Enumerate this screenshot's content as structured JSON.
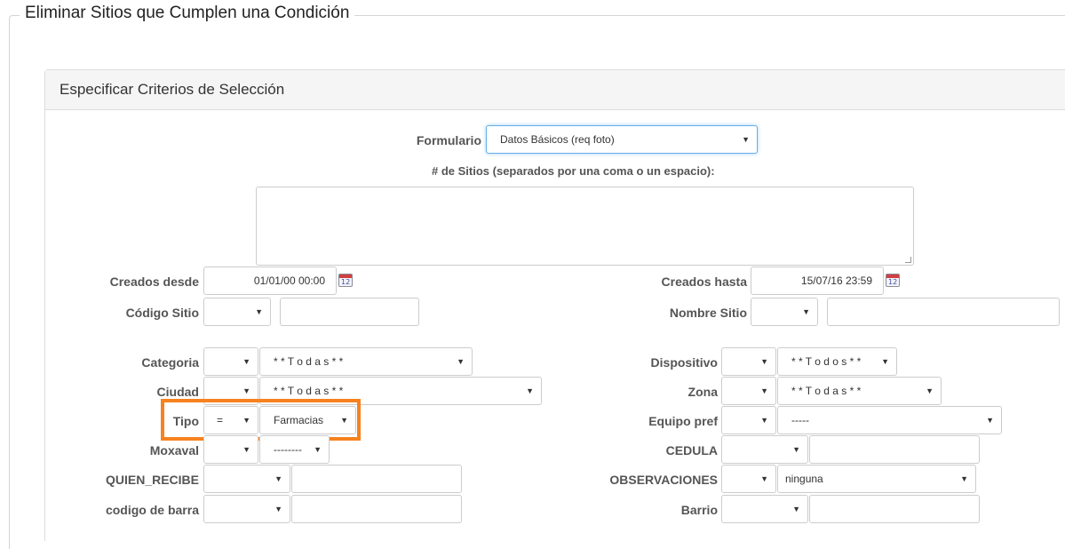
{
  "page_title": "Eliminar Sitios que Cumplen una Condición",
  "panel_title": "Especificar Criterios de Selección",
  "formulario": {
    "label": "Formulario",
    "value": "Datos Básicos (req foto)"
  },
  "sitios": {
    "label": "# de Sitios (separados por una coma o un espacio):",
    "value": ""
  },
  "creados_desde": {
    "label": "Creados desde",
    "value": "01/01/00 00:00"
  },
  "creados_hasta": {
    "label": "Creados hasta",
    "value": "15/07/16 23:59"
  },
  "calendar_icon_text": "12",
  "left_fields": {
    "codigo_sitio": {
      "label": "Código Sitio",
      "op": "",
      "value": ""
    },
    "categoria": {
      "label": "Categoria",
      "op": "",
      "value": "* * T o d a s * *"
    },
    "ciudad": {
      "label": "Ciudad",
      "op": "",
      "value": "* * T o d a s * *"
    },
    "tipo": {
      "label": "Tipo",
      "op": "=",
      "value": "Farmacias"
    },
    "moxaval": {
      "label": "Moxaval",
      "op": "",
      "value": "--------"
    },
    "quien_recibe": {
      "label": "QUIEN_RECIBE",
      "op": "",
      "value": ""
    },
    "codigo_barra": {
      "label": "codigo de barra",
      "op": "",
      "value": ""
    }
  },
  "right_fields": {
    "nombre_sitio": {
      "label": "Nombre Sitio",
      "op": "",
      "value": ""
    },
    "dispositivo": {
      "label": "Dispositivo",
      "op": "",
      "value": "* * T o d o s * *"
    },
    "zona": {
      "label": "Zona",
      "op": "",
      "value": "* * T o d a s * *"
    },
    "equipo_pref": {
      "label": "Equipo pref",
      "op": "",
      "value": "-----"
    },
    "cedula": {
      "label": "CEDULA",
      "op": "",
      "value": ""
    },
    "observaciones": {
      "label": "OBSERVACIONES",
      "op": "",
      "value": "ninguna"
    },
    "barrio": {
      "label": "Barrio",
      "op": "",
      "value": ""
    }
  },
  "icons": {
    "dropdown": "▼",
    "calendar": "calendar-icon"
  },
  "colors": {
    "highlight": "#f7821e",
    "panel_header": "#f5f5f5",
    "focus_border": "#66afe9"
  }
}
